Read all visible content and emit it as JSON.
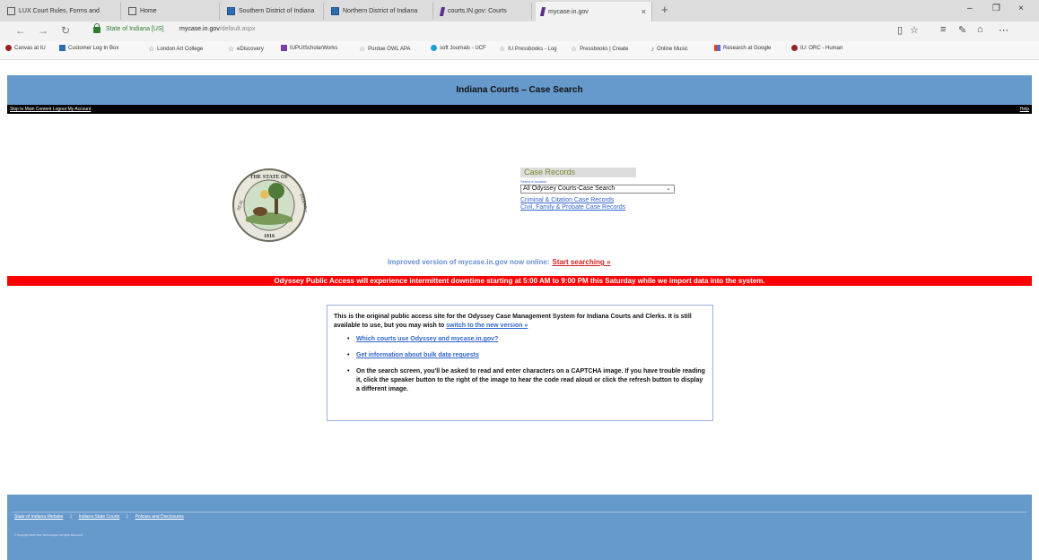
{
  "browser": {
    "tabs": [
      {
        "title": "LUX Court Rules, Forms and",
        "icon": "page-icon"
      },
      {
        "title": "Home",
        "icon": "page-icon"
      },
      {
        "title": "Southern District of Indiana",
        "icon": "court-icon"
      },
      {
        "title": "Northern District of Indiana",
        "icon": "court-icon"
      },
      {
        "title": "courts.IN.gov: Courts",
        "icon": "in-icon"
      },
      {
        "title": "mycase.in.gov",
        "icon": "in-icon",
        "active": true
      }
    ],
    "new_tab": "+",
    "close_glyph": "×",
    "window_controls": {
      "minimize": "–",
      "maximize": "❐",
      "close": "×"
    },
    "nav": {
      "back": "←",
      "forward": "→",
      "refresh": "↻"
    },
    "address": {
      "site_identity": "State of Indiana [US]",
      "url_host": "mycase.in.gov",
      "url_path": "/default.aspx"
    },
    "toolbar_icons": [
      "reading-view-icon",
      "favorite-star-icon",
      "hub-icon",
      "web-note-icon",
      "share-icon",
      "more-icon"
    ],
    "favorites": [
      {
        "label": "Canvas at IU",
        "icon": "red"
      },
      {
        "label": "Customer Log In Box",
        "icon": "blue"
      },
      {
        "label": "London Art College",
        "icon": "star"
      },
      {
        "label": "eDiscovery",
        "icon": "star"
      },
      {
        "label": "IUPUIScholarWorks",
        "icon": "sq"
      },
      {
        "label": "Purdue OWL APA",
        "icon": "star"
      },
      {
        "label": "soft Journals - UCF",
        "icon": "cyan"
      },
      {
        "label": "IU Pressbooks - Log",
        "icon": "star"
      },
      {
        "label": "Pressbooks | Create",
        "icon": "star"
      },
      {
        "label": "Online Music",
        "icon": "star"
      },
      {
        "label": "Research at Google",
        "icon": "multi"
      },
      {
        "label": "IU: ORC - Human",
        "icon": "red"
      }
    ]
  },
  "page": {
    "header_title": "Indiana Courts – Case Search",
    "skip_links": "Skip to Main Content Logout My Account",
    "help": "Help",
    "seal": {
      "top_text": "THE STATE OF",
      "left_text": "SEAL",
      "right_text": "INDIANA",
      "year": "1816"
    },
    "case_records": {
      "title": "Case Records",
      "select_label": "Select a location",
      "select_value": "All Odyssey Courts-Case Search",
      "links": [
        "Criminal & Citation Case Records",
        "Civil, Family & Probate Case Records"
      ]
    },
    "improved": {
      "text": "Improved version of mycase.in.gov now online:",
      "link": "Start searching »"
    },
    "downtime_notice": "Odyssey Public Access will experience intermittent downtime starting at 5:00 AM to 9:00 PM this Saturday while we import data into the system.",
    "info": {
      "intro": "This is the original public access site for the Odyssey Case Management System for Indiana Courts and Clerks. It is still available to use, but you may wish to",
      "intro_link": "switch to the new version »",
      "bullet1_link": "Which courts use Odyssey and mycase.in.gov?",
      "bullet2_link": "Get information about bulk data requests",
      "bullet3": "On the search screen, you'll be asked to read and enter characters on a CAPTCHA image. If you have trouble reading it, click the speaker button to the right of the image to hear the code read aloud or click the refresh button to display a different image."
    },
    "footer": {
      "links": [
        "State of Indiana Website",
        "Indiana State Courts",
        "Policies and Disclosures"
      ],
      "separator": "|",
      "copyright": "© Copyright 2003 Tyler Technologies. All rights Reserved."
    }
  },
  "colors": {
    "header": "#6699cc",
    "alert": "#ff0000",
    "link": "#3366cc",
    "case_title": "#7a8a2a"
  }
}
